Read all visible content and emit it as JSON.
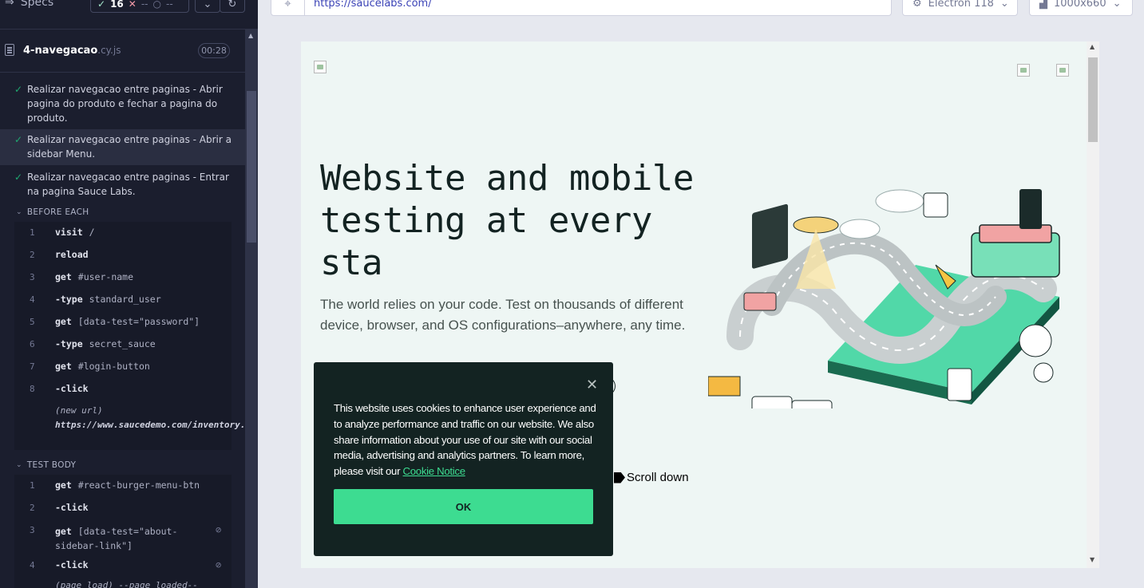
{
  "reporter": {
    "specs_label": "Specs",
    "stats": {
      "passed": "16",
      "failed": "--",
      "pending": "--"
    },
    "spec": {
      "name": "4-navegacao",
      "ext": ".cy.js",
      "duration": "00:28"
    },
    "tests": [
      {
        "title": "Realizar navegacao entre paginas - Abrir pagina do produto e fechar a pagina do produto."
      },
      {
        "title": "Realizar navegacao entre paginas - Abrir a sidebar Menu."
      },
      {
        "title": "Realizar navegacao entre paginas - Entrar na pagina Sauce Labs."
      }
    ],
    "before_each": {
      "label": "BEFORE EACH",
      "commands": [
        {
          "num": "1",
          "name": "visit",
          "arg": "/"
        },
        {
          "num": "2",
          "name": "reload",
          "arg": ""
        },
        {
          "num": "3",
          "name": "get",
          "arg": "#user-name"
        },
        {
          "num": "4",
          "name": "-type",
          "arg": "standard_user"
        },
        {
          "num": "5",
          "name": "get",
          "arg": "[data-test=\"password\"]"
        },
        {
          "num": "6",
          "name": "-type",
          "arg": "secret_sauce"
        },
        {
          "num": "7",
          "name": "get",
          "arg": "#login-button"
        },
        {
          "num": "8",
          "name": "-click",
          "arg": ""
        }
      ],
      "note_prefix": "(new url)",
      "note_url": "https://www.saucedemo.com/inventory.html"
    },
    "test_body": {
      "label": "TEST BODY",
      "commands": [
        {
          "num": "1",
          "name": "get",
          "arg": "#react-burger-menu-btn"
        },
        {
          "num": "2",
          "name": "-click",
          "arg": ""
        },
        {
          "num": "3",
          "name": "get",
          "arg": "[data-test=\"about-sidebar-link\"]"
        },
        {
          "num": "4",
          "name": "-click",
          "arg": ""
        }
      ],
      "trailing": "(page load) --page loaded--"
    }
  },
  "aut": {
    "url": "https://saucelabs.com/",
    "browser": "Electron 118",
    "viewport_size": "1000x660"
  },
  "page": {
    "hero_title": "Website and mobile testing at every sta",
    "hero_subtitle": "The world relies on your code. Test on thousands of different device, browser, and OS configurations–anywhere, any time.",
    "scroll_down": "Scroll down",
    "cookie": {
      "text": "This website uses cookies to enhance user experience and to analyze performance and traffic on our website. We also share information about your use of our site with our social media, advertising and analytics partners. To learn more, please visit our",
      "link": "Cookie Notice",
      "ok": "OK"
    }
  },
  "colors": {
    "reporter_bg": "#1b1e2e",
    "pass_green": "#1fa971",
    "saucelabs_green": "#3ddc91",
    "cookie_bg": "#132322"
  }
}
